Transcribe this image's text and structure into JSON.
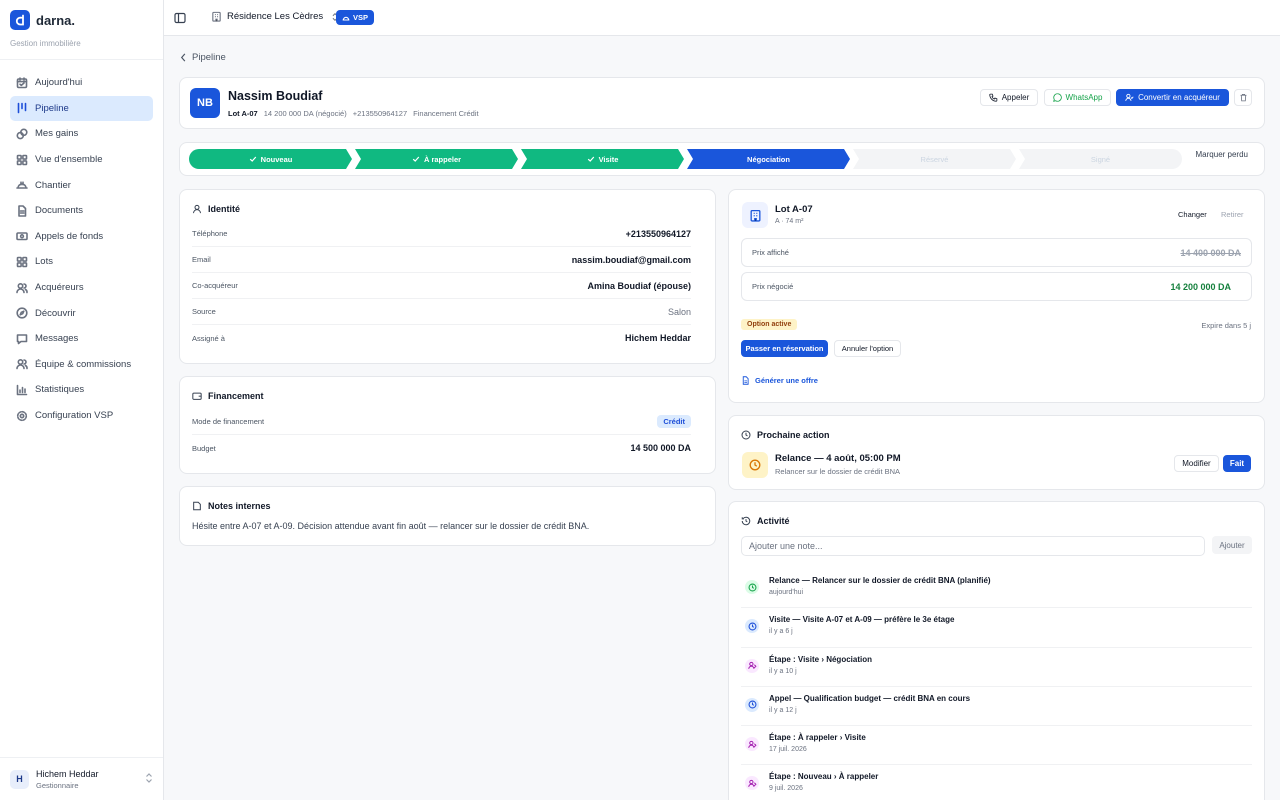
{
  "app": {
    "name": "darna.",
    "subtitle": "Gestion immobilière"
  },
  "sidebar": {
    "items": [
      {
        "label": "Aujourd'hui",
        "icon": "calendar-icon",
        "active": false
      },
      {
        "label": "Pipeline",
        "icon": "pipeline-icon",
        "active": true
      },
      {
        "label": "Mes gains",
        "icon": "coins-icon",
        "active": false
      },
      {
        "label": "Vue d'ensemble",
        "icon": "grid-icon",
        "active": false
      },
      {
        "label": "Chantier",
        "icon": "helmet-icon",
        "active": false
      },
      {
        "label": "Documents",
        "icon": "document-icon",
        "active": false
      },
      {
        "label": "Appels de fonds",
        "icon": "banknote-icon",
        "active": false
      },
      {
        "label": "Lots",
        "icon": "lots-icon",
        "active": false
      },
      {
        "label": "Acquéreurs",
        "icon": "users-icon",
        "active": false
      },
      {
        "label": "Découvrir",
        "icon": "compass-icon",
        "active": false
      },
      {
        "label": "Messages",
        "icon": "message-icon",
        "active": false
      },
      {
        "label": "Équipe & commissions",
        "icon": "team-icon",
        "active": false
      },
      {
        "label": "Statistiques",
        "icon": "chart-icon",
        "active": false
      },
      {
        "label": "Configuration VSP",
        "icon": "settings-icon",
        "active": false
      }
    ],
    "user": {
      "initial": "H",
      "name": "Hichem Heddar",
      "role": "Gestionnaire"
    }
  },
  "topbar": {
    "project": "Résidence Les Cèdres",
    "badge": "VSP"
  },
  "breadcrumb": "Pipeline",
  "prospect": {
    "initials": "NB",
    "name": "Nassim Boudiaf",
    "lot": "Lot A-07",
    "price": "14 200 000 DA (négocié)",
    "phone": "+213550964127",
    "financing": "Financement Crédit",
    "actions": {
      "call": "Appeler",
      "whatsapp": "WhatsApp",
      "convert": "Convertir en acquéreur"
    }
  },
  "stages": {
    "steps": [
      "Nouveau",
      "À rappeler",
      "Visite",
      "Négociation",
      "Réservé",
      "Signé"
    ],
    "lost": "Marquer perdu"
  },
  "identity": {
    "title": "Identité",
    "rows": [
      {
        "k": "Téléphone",
        "v": "+213550964127"
      },
      {
        "k": "Email",
        "v": "nassim.boudiaf@gmail.com"
      },
      {
        "k": "Co-acquéreur",
        "v": "Amina Boudiaf (épouse)"
      },
      {
        "k": "Source",
        "v": "Salon"
      },
      {
        "k": "Assigné à",
        "v": "Hichem Heddar"
      }
    ]
  },
  "financing": {
    "title": "Financement",
    "mode_label": "Mode de financement",
    "mode_value": "Crédit",
    "budget_label": "Budget",
    "budget_value": "14 500 000 DA"
  },
  "notes": {
    "title": "Notes internes",
    "text": "Hésite entre A-07 et A-09. Décision attendue avant fin août — relancer sur le dossier de crédit BNA."
  },
  "lot_card": {
    "title": "Lot A-07",
    "sub": "A · 74 m²",
    "change": "Changer",
    "remove": "Retirer",
    "listed_label": "Prix affiché",
    "listed_value": "14 400 000 DA",
    "negotiated_label": "Prix négocié",
    "negotiated_value": "14 200 000 DA",
    "option_chip": "Option active",
    "expires": "Expire dans 5 j",
    "reserve_btn": "Passer en réservation",
    "cancel_btn": "Annuler l'option",
    "offer_link": "Générer une offre"
  },
  "next_action": {
    "title": "Prochaine action",
    "action_title": "Relance — 4 août, 05:00 PM",
    "action_sub": "Relancer sur le dossier de crédit BNA",
    "edit": "Modifier",
    "done": "Fait"
  },
  "activity": {
    "title": "Activité",
    "placeholder": "Ajouter une note...",
    "add": "Ajouter",
    "items": [
      {
        "title": "Relance — Relancer sur le dossier de crédit BNA (planifié)",
        "time": "aujourd'hui",
        "kind": "clock-green"
      },
      {
        "title": "Visite — Visite A-07 et A-09 — préfère le 3e étage",
        "time": "il y a 6 j",
        "kind": "clock-blue"
      },
      {
        "title": "Étape : Visite › Négociation",
        "time": "il y a 10 j",
        "kind": "stage"
      },
      {
        "title": "Appel — Qualification budget — crédit BNA en cours",
        "time": "il y a 12 j",
        "kind": "clock-blue"
      },
      {
        "title": "Étape : À rappeler › Visite",
        "time": "17 juil. 2026",
        "kind": "stage"
      },
      {
        "title": "Étape : Nouveau › À rappeler",
        "time": "9 juil. 2026",
        "kind": "stage"
      }
    ]
  },
  "colors": {
    "primary": "#1a56db",
    "done": "#10b981",
    "danger": "#ef4444"
  }
}
